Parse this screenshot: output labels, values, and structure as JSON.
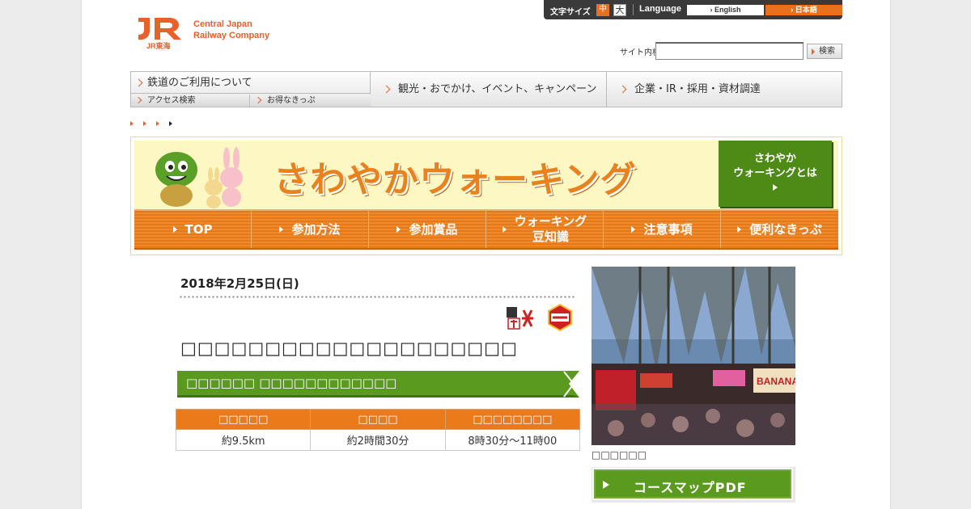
{
  "header": {
    "company_name_line1": "Central Japan",
    "company_name_line2": "Railway Company",
    "logo_jr": "JR",
    "logo_sub": "JR東海",
    "font_size_label": "文字サイズ",
    "font_size_mid": "中",
    "font_size_large": "大",
    "language_label": "Language",
    "lang_english": "English",
    "lang_japanese": "日本語",
    "search_label": "サイト内検索",
    "search_value": "",
    "search_button": "検索"
  },
  "global_nav": {
    "railway": "鉄道のご利用について",
    "access_search": "アクセス検索",
    "deal_tickets": "お得なきっぷ",
    "tourism": "観光・おでかけ、イベント、キャンペーン",
    "corporate": "企業・IR・採用・資材調達"
  },
  "banner": {
    "title": "さわやかウォーキング",
    "about_line1": "さわやか",
    "about_line2": "ウォーキングとは"
  },
  "section_nav": [
    {
      "label": "TOP"
    },
    {
      "label": "参加方法"
    },
    {
      "label": "参加賞品"
    },
    {
      "label": "ウォーキング\n豆知識"
    },
    {
      "label": "注意事項"
    },
    {
      "label": "便利なきっぷ"
    }
  ],
  "event": {
    "date": "2018年2月25日(日)",
    "title": "□□□□□□□□□□□□□□□□□□□□",
    "course": "□□□□□□ □□□□□□□□□□□□",
    "table_headers": [
      "□□□□□",
      "□□□□",
      "□□□□□□□□"
    ],
    "table_values": [
      "約9.5km",
      "約2時間30分",
      "8時30分～11時00"
    ]
  },
  "sidebar": {
    "photo_caption": "□□□□□□",
    "pdf_button": "コースマップPDF"
  },
  "colors": {
    "brand_orange": "#e8602a",
    "nav_orange": "#ea7a1a",
    "green": "#5a9a1e"
  }
}
